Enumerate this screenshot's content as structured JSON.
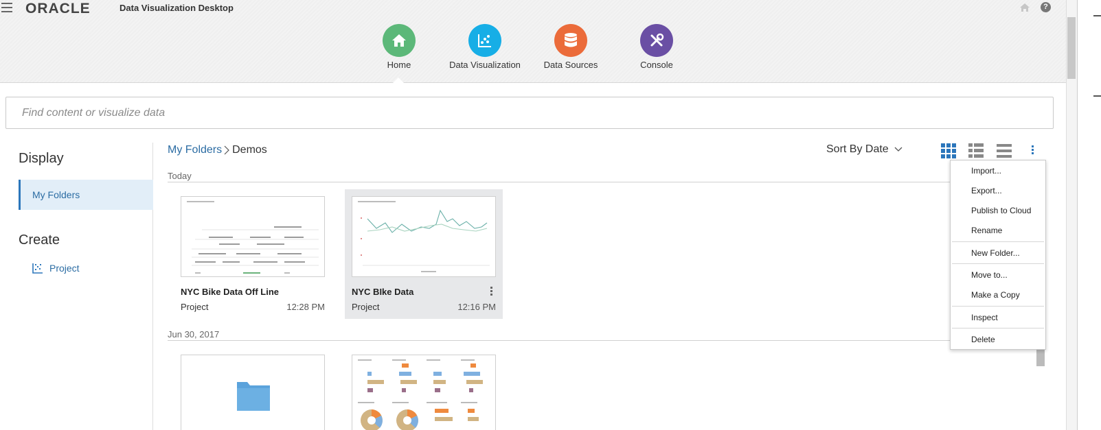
{
  "header": {
    "logo": "ORACLE",
    "app_title": "Data Visualization Desktop",
    "nav": [
      {
        "label": "Home",
        "icon": "home-icon",
        "color": "#5cb879"
      },
      {
        "label": "Data Visualization",
        "icon": "scatter-chart-icon",
        "color": "#17aee6"
      },
      {
        "label": "Data Sources",
        "icon": "database-icon",
        "color": "#eb6b3a"
      },
      {
        "label": "Console",
        "icon": "tools-icon",
        "color": "#6a4fa4"
      }
    ],
    "help_label": "?"
  },
  "search": {
    "placeholder": "Find content or visualize data"
  },
  "sidebar": {
    "display_heading": "Display",
    "my_folders": "My Folders",
    "create_heading": "Create",
    "project": "Project"
  },
  "breadcrumb": {
    "parent": "My Folders",
    "current": "Demos"
  },
  "sort": {
    "label": "Sort By Date"
  },
  "groups": [
    {
      "label": "Today",
      "items": [
        {
          "title": "NYC Bike Data Off Line",
          "type": "Project",
          "time": "12:28 PM"
        },
        {
          "title": "NYC BIke Data",
          "type": "Project",
          "time": "12:16 PM"
        }
      ]
    },
    {
      "label": "Jun 30, 2017",
      "items": [
        {
          "kind": "folder"
        },
        {
          "kind": "project"
        }
      ]
    }
  ],
  "context_menu": {
    "items": [
      "Import...",
      "Export...",
      "Publish to Cloud",
      "Rename",
      "New Folder...",
      "Move to...",
      "Make a Copy",
      "Inspect",
      "Delete"
    ]
  },
  "colors": {
    "accent": "#2b76bb",
    "link": "#2b6ca3",
    "selected_bg": "#e2eef8"
  }
}
